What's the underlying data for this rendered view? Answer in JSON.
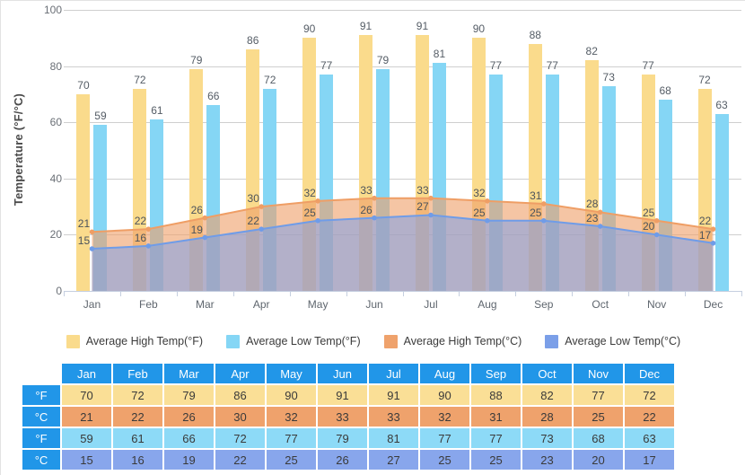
{
  "chart_data": {
    "type": "bar",
    "title": "",
    "xlabel": "",
    "ylabel": "Temperature (°F/°C)",
    "ylim": [
      0,
      100
    ],
    "yticks": [
      0,
      20,
      40,
      60,
      80,
      100
    ],
    "grid": true,
    "legend_position": "bottom",
    "categories": [
      "Jan",
      "Feb",
      "Mar",
      "Apr",
      "May",
      "Jun",
      "Jul",
      "Aug",
      "Sep",
      "Oct",
      "Nov",
      "Dec"
    ],
    "series": [
      {
        "name": "Average High Temp(°F)",
        "type": "bar",
        "color": "#fadb8c",
        "values": [
          70,
          72,
          79,
          86,
          90,
          91,
          91,
          90,
          88,
          82,
          77,
          72
        ]
      },
      {
        "name": "Average Low Temp(°F)",
        "type": "bar",
        "color": "#85d6f5",
        "values": [
          59,
          61,
          66,
          72,
          77,
          79,
          81,
          77,
          77,
          73,
          68,
          63
        ]
      },
      {
        "name": "Average High Temp(°C)",
        "type": "area",
        "color": "#efa26c",
        "values": [
          21,
          22,
          26,
          30,
          32,
          33,
          33,
          32,
          31,
          28,
          25,
          22
        ]
      },
      {
        "name": "Average Low Temp(°C)",
        "type": "area",
        "color": "#7b9fe8",
        "values": [
          15,
          16,
          19,
          22,
          25,
          26,
          27,
          25,
          25,
          23,
          20,
          17
        ]
      }
    ]
  },
  "legend": {
    "items": [
      {
        "label": "Average High Temp(°F)",
        "color": "#fadb8c"
      },
      {
        "label": "Average Low Temp(°F)",
        "color": "#85d6f5"
      },
      {
        "label": "Average High Temp(°C)",
        "color": "#efa26c"
      },
      {
        "label": "Average Low Temp(°C)",
        "color": "#7b9fe8"
      }
    ]
  },
  "table": {
    "corner": "",
    "columns": [
      "Jan",
      "Feb",
      "Mar",
      "Apr",
      "May",
      "Jun",
      "Jul",
      "Aug",
      "Sep",
      "Oct",
      "Nov",
      "Dec"
    ],
    "rows": [
      {
        "unit": "°F",
        "style": "v-highf",
        "values": [
          70,
          72,
          79,
          86,
          90,
          91,
          91,
          90,
          88,
          82,
          77,
          72
        ]
      },
      {
        "unit": "°C",
        "style": "v-highc",
        "values": [
          21,
          22,
          26,
          30,
          32,
          33,
          33,
          32,
          31,
          28,
          25,
          22
        ]
      },
      {
        "unit": "°F",
        "style": "v-lowf",
        "values": [
          59,
          61,
          66,
          72,
          77,
          79,
          81,
          77,
          77,
          73,
          68,
          63
        ]
      },
      {
        "unit": "°C",
        "style": "v-lowc",
        "values": [
          15,
          16,
          19,
          22,
          25,
          26,
          27,
          25,
          25,
          23,
          20,
          17
        ]
      }
    ]
  },
  "colors": {
    "high_f": "#fadb8c",
    "low_f": "#85d6f5",
    "high_c": "#efa26c",
    "low_c": "#7b9fe8",
    "table_header": "#2196e8",
    "gridline": "#cfcfcf"
  }
}
